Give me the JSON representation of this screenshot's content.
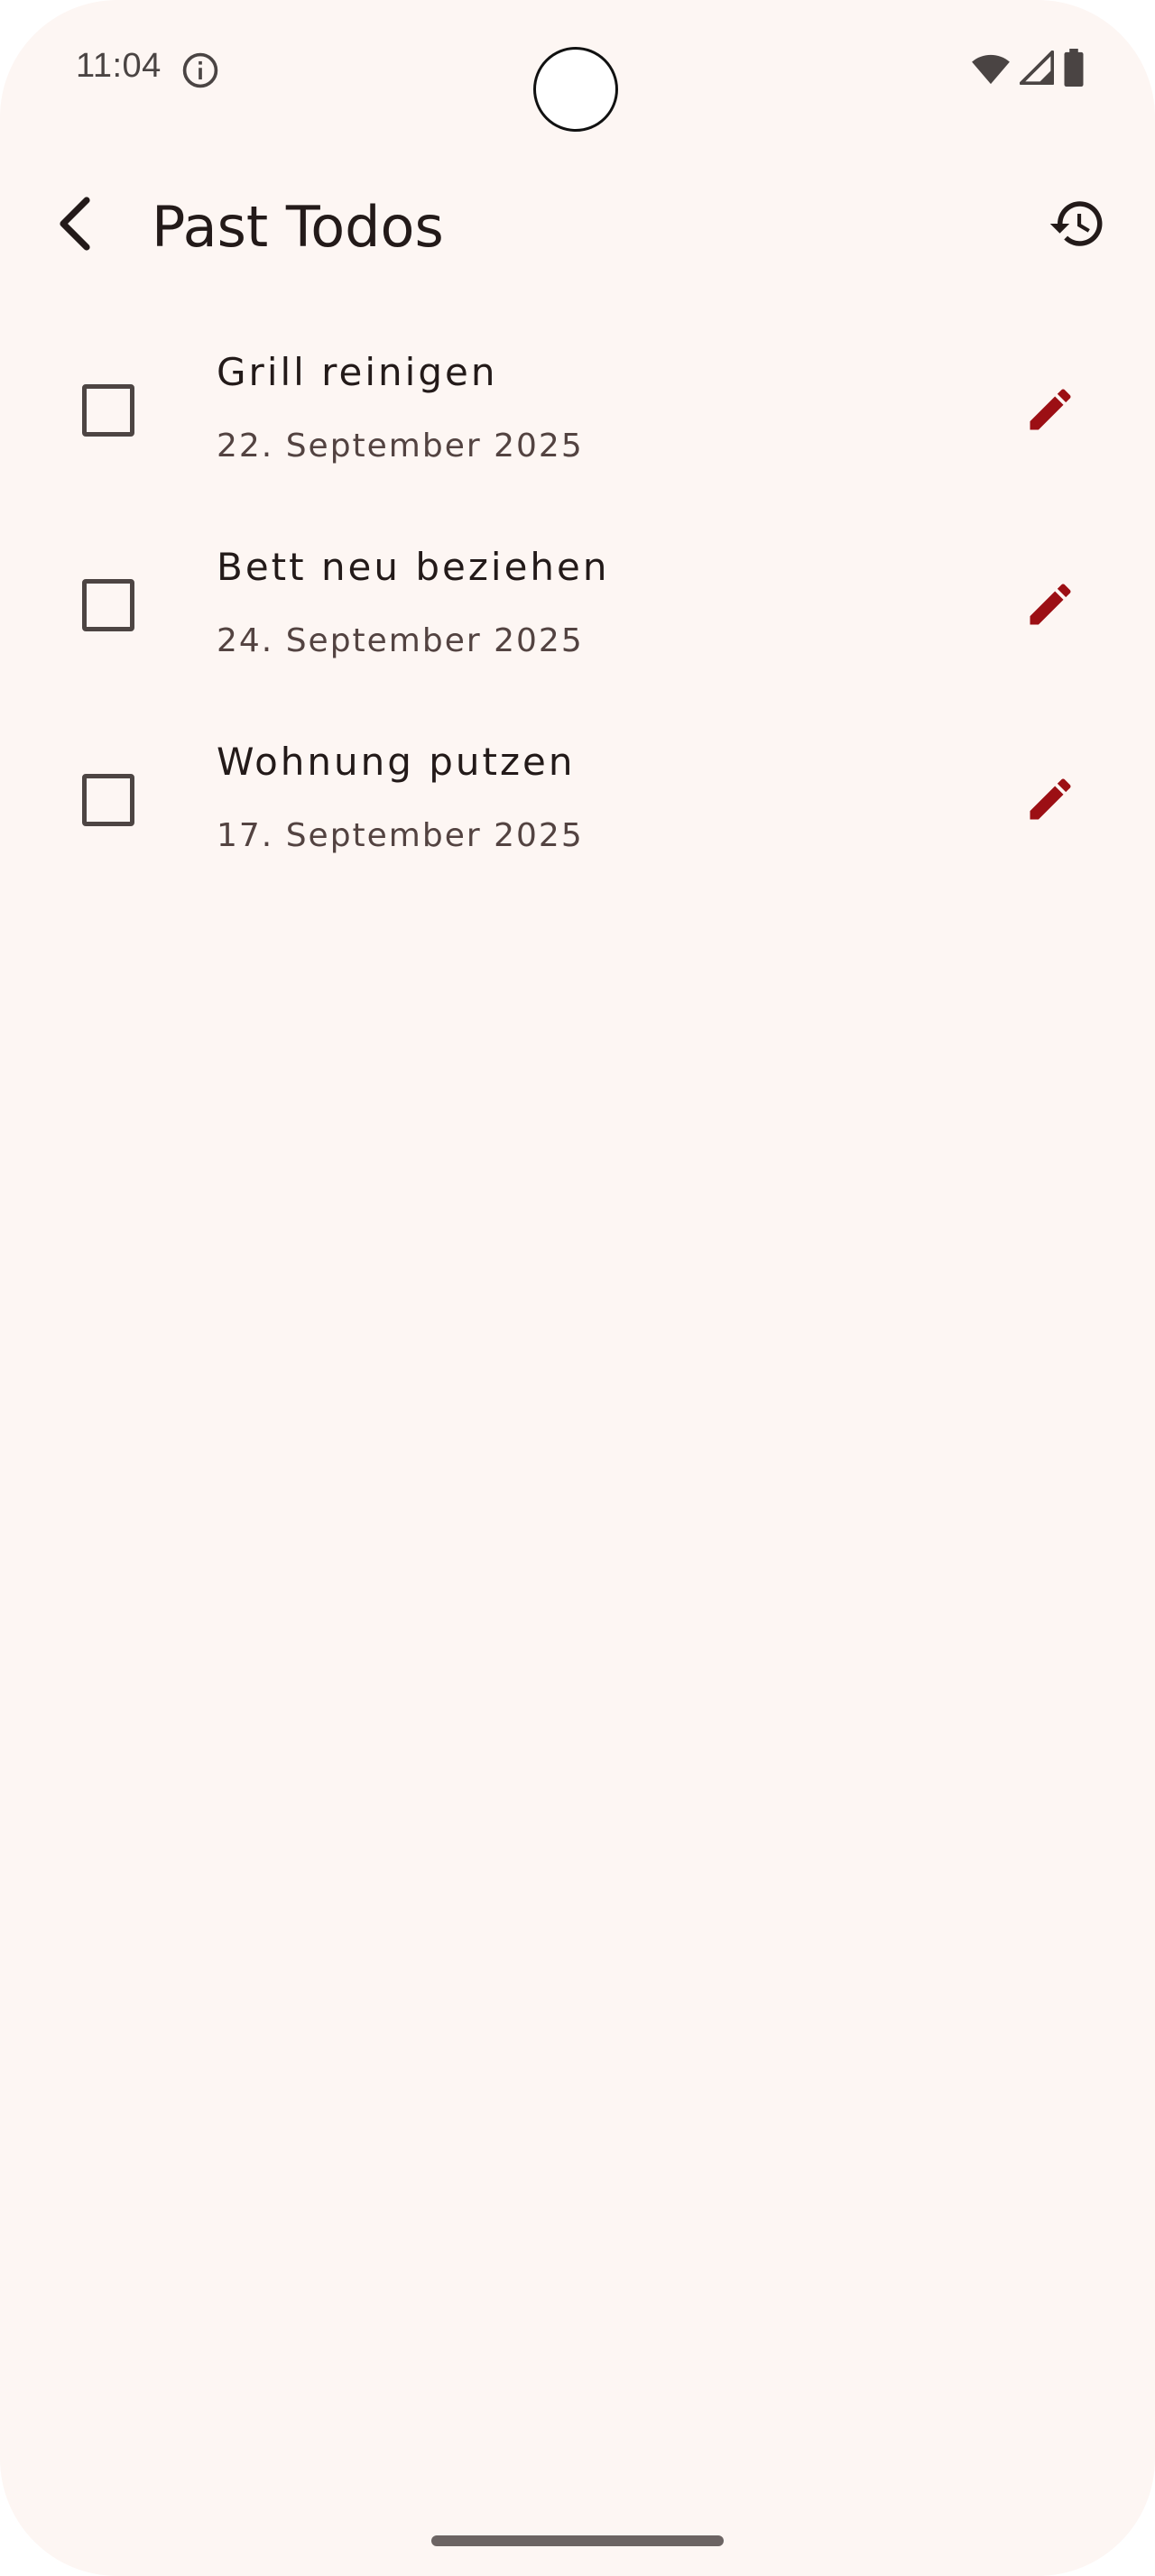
{
  "status_bar": {
    "time": "11:04",
    "info_icon": "info-circle-icon",
    "wifi_icon": "wifi-icon",
    "signal_icon": "cell-signal-icon",
    "battery_icon": "battery-icon"
  },
  "app_bar": {
    "title": "Past Todos",
    "back_icon": "chevron-left-icon",
    "history_icon": "history-icon"
  },
  "todos": [
    {
      "title": "Grill reinigen",
      "date": "22. September 2025",
      "checked": false
    },
    {
      "title": "Bett neu beziehen",
      "date": "24. September 2025",
      "checked": false
    },
    {
      "title": "Wohnung putzen",
      "date": "17. September 2025",
      "checked": false
    }
  ],
  "colors": {
    "background": "#fdf6f3",
    "text_primary": "#231a19",
    "text_secondary": "#534341",
    "accent_edit": "#9c0f14",
    "icon_dark": "#4a4443"
  }
}
